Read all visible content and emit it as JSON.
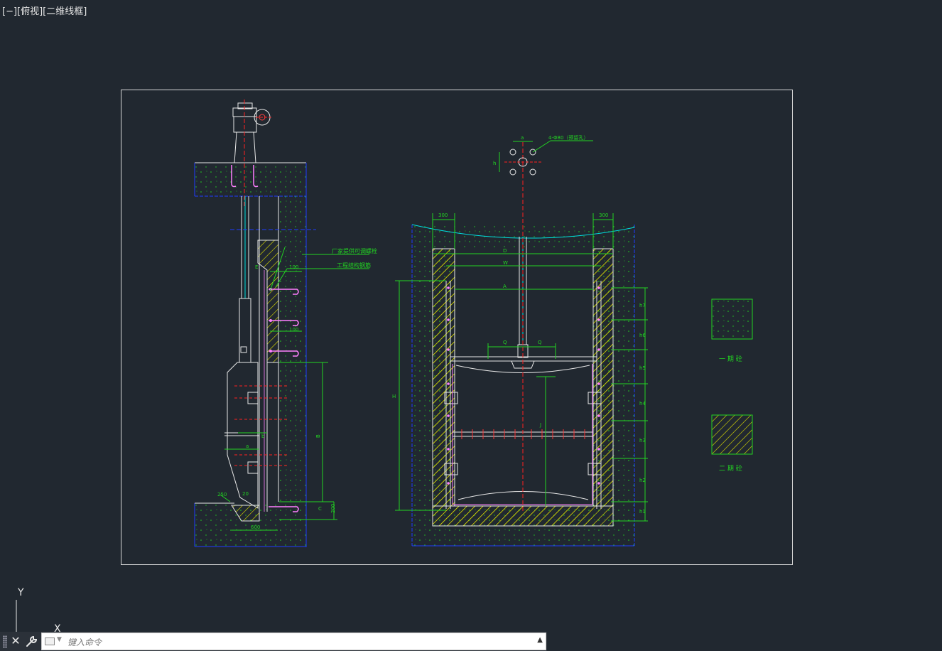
{
  "viewport": {
    "controls": "[−][俯视][二维线框]"
  },
  "ucs": {
    "y_label": "Y",
    "x_label": "X"
  },
  "drawing": {
    "annotations": {
      "note_vendor_bolt": "厂家提供可调螺栓",
      "note_site_rebar": "工程结构钢筋",
      "note_holes": "4-Φ80（预留孔）",
      "dim_100_a": "100",
      "dim_100_b": "100",
      "dim_300_left": "300",
      "dim_300_right": "300",
      "dim_600": "600",
      "dim_200": "200",
      "dim_20": "20",
      "dim_250": "250",
      "label_B": "B",
      "label_C": "C",
      "label_D": "D",
      "label_W": "W",
      "label_A": "A",
      "label_H": "H",
      "label_Q_left": "Q",
      "label_Q_right": "Q",
      "label_J": "J",
      "label_E": "E",
      "label_a": "a",
      "label_b": "b",
      "label_h": "h",
      "label_F": "F",
      "h_labels": [
        "h7",
        "h6",
        "h5",
        "h4",
        "h3",
        "h2",
        "h1"
      ]
    },
    "legend": {
      "first_stage": "一 期 砼",
      "second_stage": "二 期 砼"
    }
  },
  "commandline": {
    "placeholder": "键入命令",
    "close_icon": "close-icon",
    "settings_icon": "wrench-icon"
  }
}
